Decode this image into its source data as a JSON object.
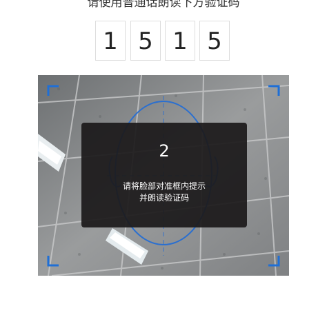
{
  "instruction": "请使用普通话朗读下方验证码",
  "code_digits": [
    "1",
    "5",
    "1",
    "5"
  ],
  "camera": {
    "countdown": "2",
    "hint_line1": "请将脸部对准框内提示",
    "hint_line2": "并朗读验证码"
  },
  "colors": {
    "frame_corner": "#1f6fd6",
    "face_guide": "#2a6fd0",
    "overlay": "#1c1a1b"
  },
  "icons": {
    "face_guide": "face-outline-icon",
    "corners": "viewfinder-corner-icon"
  }
}
